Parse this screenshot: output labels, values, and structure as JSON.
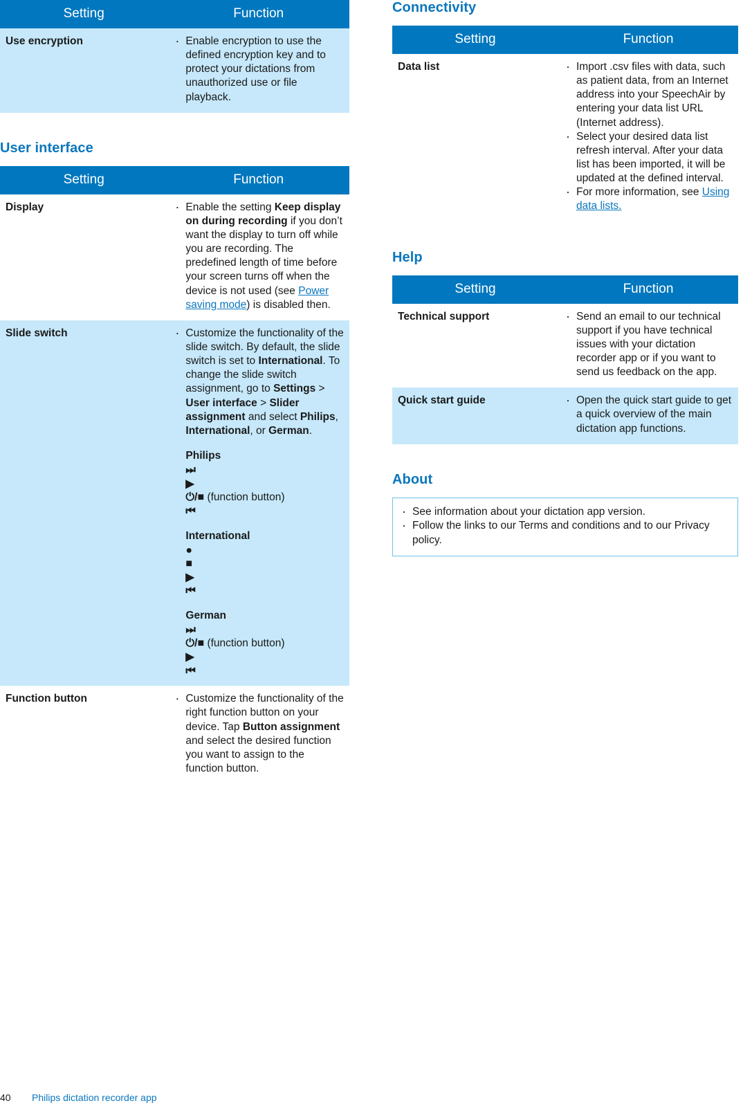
{
  "page": {
    "footer_page_number": "40",
    "footer_text": "Philips dictation recorder app"
  },
  "colors": {
    "header_blue": "#0077be",
    "row_shade": "#c6e8fa",
    "heading_blue": "#0b76bd",
    "link_blue": "#0b76bd",
    "about_border": "#6cc0e8"
  },
  "table_headers": {
    "setting": "Setting",
    "function": "Function"
  },
  "left_column": {
    "encryption_table": {
      "rows": [
        {
          "setting": "Use encryption",
          "bullets": [
            "Enable encryption to use the defined encryption key and to protect your dictations from unauthorized use or file playback."
          ]
        }
      ]
    },
    "user_interface": {
      "title": "User interface",
      "rows": [
        {
          "setting": "Display",
          "bullet_parts": [
            {
              "t": "Enable the setting "
            },
            {
              "t": "Keep display on during recording",
              "b": true
            },
            {
              "t": " if you don’t want the display to turn off while you are recording. The predefined length of time before your screen turns off when the device is not used (see "
            },
            {
              "t": "Power saving mode",
              "link": true
            },
            {
              "t": ") is disabled then."
            }
          ]
        },
        {
          "setting": "Slide switch",
          "bullet_parts": [
            {
              "t": "Customize the functionality of the slide switch. By default, the slide switch is set to "
            },
            {
              "t": "International",
              "b": true
            },
            {
              "t": ". To change the slide switch assignment, go to "
            },
            {
              "t": "Settings",
              "b": true
            },
            {
              "t": " > "
            },
            {
              "t": "User interface",
              "b": true
            },
            {
              "t": " > "
            },
            {
              "t": "Slider assignment",
              "b": true
            },
            {
              "t": " and select "
            },
            {
              "t": "Philips",
              "b": true
            },
            {
              "t": ", "
            },
            {
              "t": "International",
              "b": true
            },
            {
              "t": ", or "
            },
            {
              "t": "German",
              "b": true
            },
            {
              "t": "."
            }
          ],
          "symbol_groups": [
            {
              "label": "Philips",
              "lines": [
                {
                  "sym": "⏭",
                  "note": ""
                },
                {
                  "sym": "▶",
                  "note": ""
                },
                {
                  "sym": "⏻/■",
                  "note": " (function button)"
                },
                {
                  "sym": "⏮",
                  "note": ""
                }
              ]
            },
            {
              "label": "International",
              "lines": [
                {
                  "sym": "●",
                  "note": ""
                },
                {
                  "sym": "■",
                  "note": ""
                },
                {
                  "sym": "▶",
                  "note": ""
                },
                {
                  "sym": "⏮",
                  "note": ""
                }
              ]
            },
            {
              "label": "German",
              "lines": [
                {
                  "sym": "⏭",
                  "note": ""
                },
                {
                  "sym": "⏻/■",
                  "note": " (function button)"
                },
                {
                  "sym": "▶",
                  "note": ""
                },
                {
                  "sym": "⏮",
                  "note": ""
                }
              ]
            }
          ]
        },
        {
          "setting": "Function button",
          "bullet_parts": [
            {
              "t": "Customize the functionality of the right function button on your device. Tap "
            },
            {
              "t": "Button assignment",
              "b": true
            },
            {
              "t": " and select the desired function you want to assign to the function button."
            }
          ]
        }
      ]
    }
  },
  "right_column": {
    "connectivity": {
      "title": "Connectivity",
      "rows": [
        {
          "setting": "Data list",
          "bullets_parts": [
            [
              {
                "t": "Import .csv files with data, such as patient data, from an Internet address into your SpeechAir by entering your data list URL (Internet address)."
              }
            ],
            [
              {
                "t": "Select your desired data list refresh interval. After your data list has been imported, it will be updated at the defined interval."
              }
            ],
            [
              {
                "t": "For more information, see "
              },
              {
                "t": "Using data lists.",
                "link": true
              }
            ]
          ]
        }
      ]
    },
    "help": {
      "title": "Help",
      "rows": [
        {
          "setting": "Technical support",
          "bullets": [
            "Send an email to our technical support if you have technical issues with your dictation recorder app or if you want to send us feedback on the app."
          ]
        },
        {
          "setting": "Quick start guide",
          "bullets": [
            "Open the quick start guide to get a quick overview of the main dictation app functions."
          ]
        }
      ]
    },
    "about": {
      "title": "About",
      "bullets": [
        "See information about your dictation app version.",
        "Follow the links to our Terms and conditions and to our Privacy policy."
      ]
    }
  }
}
